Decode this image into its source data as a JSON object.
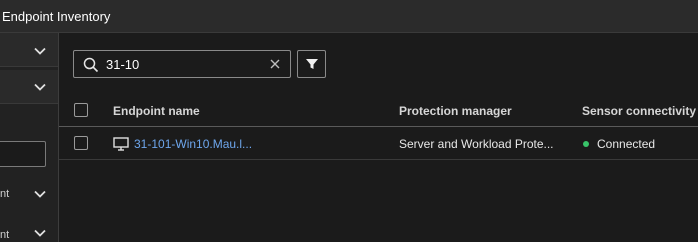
{
  "window": {
    "title": "Endpoint Inventory"
  },
  "sidebar": {
    "items": [
      {
        "label": "",
        "icon": "chevron-down-icon"
      },
      {
        "label": "",
        "icon": "chevron-down-icon"
      },
      {
        "label": "nt",
        "icon": "chevron-down-icon"
      },
      {
        "label": "nt",
        "icon": "chevron-down-icon"
      }
    ],
    "input_value": ""
  },
  "search": {
    "value": "31-10",
    "icon": "search-icon",
    "clear_icon": "close-icon"
  },
  "filter": {
    "icon": "filter-icon"
  },
  "table": {
    "columns": [
      "Endpoint name",
      "Protection manager",
      "Sensor connectivity"
    ],
    "rows": [
      {
        "endpoint_name": "31-101-Win10.Mau.l...",
        "protection_manager": "Server and Workload Prote...",
        "sensor_connectivity": "Connected",
        "icon": "monitor-icon",
        "status_color": "#39c46a"
      }
    ]
  },
  "colors": {
    "link": "#6ea6ec",
    "connected": "#39c46a",
    "background": "#1b1b1b"
  }
}
